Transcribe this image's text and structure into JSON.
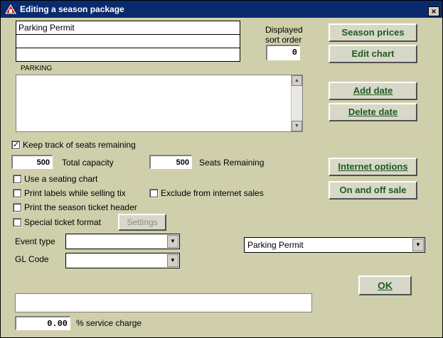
{
  "window": {
    "title": "Editing a season package",
    "close_glyph": "×"
  },
  "package": {
    "name": "Parking Permit",
    "line2": "",
    "line3": "",
    "category": "PARKING",
    "description": ""
  },
  "sort_order": {
    "label": "Displayed sort order",
    "value": "0"
  },
  "buttons": {
    "season_prices": "Season prices",
    "edit_chart": "Edit chart",
    "add_date": "Add  date",
    "delete_date": "Delete date",
    "internet_options": "Internet options",
    "on_off_sale": "On and off sale",
    "settings": "Settings",
    "ok": "OK"
  },
  "seats": {
    "keep_track_label": "Keep track of seats remaining",
    "keep_track_checked": "✓",
    "total_capacity_value": "500",
    "total_capacity_label": "Total capacity",
    "seats_remaining_value": "500",
    "seats_remaining_label": "Seats Remaining"
  },
  "options": {
    "use_seating_chart": "Use a seating chart",
    "print_labels": "Print labels while selling tix",
    "exclude_internet": "Exclude from internet sales",
    "print_header": "Print the season ticket header",
    "special_format": "Special ticket format"
  },
  "fields": {
    "event_type_label": "Event type",
    "event_type_value": "",
    "gl_code_label": "GL Code",
    "gl_code_value": "",
    "package_select_value": "Parking Permit",
    "notes_value": "",
    "service_charge_value": "0.00",
    "service_charge_label": "% service charge"
  },
  "icons": {
    "app": "app-icon",
    "dropdown": "chevron-down-icon",
    "checkmark": "checkmark-icon"
  }
}
